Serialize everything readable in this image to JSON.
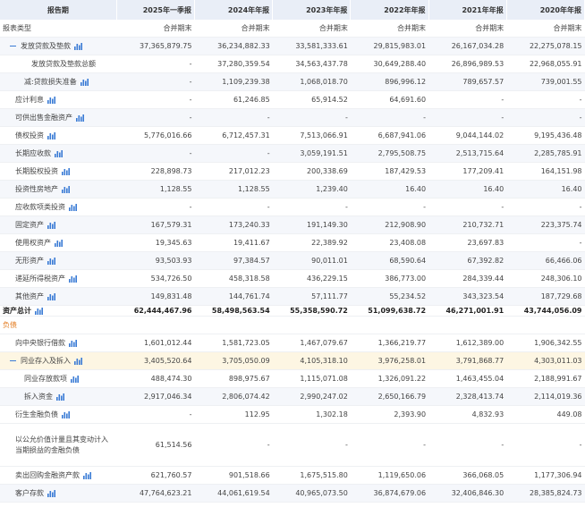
{
  "columns": [
    "报告期",
    "2025年一季报",
    "2024年年报",
    "2023年年报",
    "2022年年报",
    "2021年年报",
    "2020年年报"
  ],
  "rows": [
    {
      "label": "报表类型",
      "values": [
        "合并期末",
        "合并期末",
        "合并期末",
        "合并期末",
        "合并期末",
        "合并期末"
      ],
      "indent": 0,
      "chart": false,
      "style": "sub"
    },
    {
      "label": "发放贷款及垫款",
      "values": [
        "37,365,879.75",
        "36,234,882.33",
        "33,581,333.61",
        "29,815,983.01",
        "26,167,034.28",
        "22,275,078.15"
      ],
      "indent": 1,
      "chart": true,
      "collapse": true,
      "style": "alt"
    },
    {
      "label": "发放贷款及垫款总额",
      "values": [
        "-",
        "37,280,359.54",
        "34,563,437.78",
        "30,649,288.40",
        "26,896,989.53",
        "22,968,055.91"
      ],
      "indent": 3,
      "chart": false,
      "style": "row"
    },
    {
      "label": "减:贷款损失准备",
      "values": [
        "-",
        "1,109,239.38",
        "1,068,018.70",
        "896,996.12",
        "789,657.57",
        "739,001.55"
      ],
      "indent": 2,
      "chart": true,
      "style": "alt"
    },
    {
      "label": "应计利息",
      "values": [
        "-",
        "61,246.85",
        "65,914.52",
        "64,691.60",
        "-",
        "-"
      ],
      "indent": 1,
      "chart": true,
      "style": "row"
    },
    {
      "label": "可供出售金融资产",
      "values": [
        "-",
        "-",
        "-",
        "-",
        "-",
        "-"
      ],
      "indent": 1,
      "chart": true,
      "style": "alt"
    },
    {
      "label": "债权投资",
      "values": [
        "5,776,016.66",
        "6,712,457.31",
        "7,513,066.91",
        "6,687,941.06",
        "9,044,144.02",
        "9,195,436.48"
      ],
      "indent": 1,
      "chart": true,
      "style": "row"
    },
    {
      "label": "长期应收款",
      "values": [
        "-",
        "-",
        "3,059,191.51",
        "2,795,508.75",
        "2,513,715.64",
        "2,285,785.91"
      ],
      "indent": 1,
      "chart": true,
      "style": "alt"
    },
    {
      "label": "长期股权投资",
      "values": [
        "228,898.73",
        "217,012.23",
        "200,338.69",
        "187,429.53",
        "177,209.41",
        "164,151.98"
      ],
      "indent": 1,
      "chart": true,
      "style": "row"
    },
    {
      "label": "投资性房地产",
      "values": [
        "1,128.55",
        "1,128.55",
        "1,239.40",
        "16.40",
        "16.40",
        "16.40"
      ],
      "indent": 1,
      "chart": true,
      "style": "alt"
    },
    {
      "label": "应收款项类投资",
      "values": [
        "-",
        "-",
        "-",
        "-",
        "-",
        "-"
      ],
      "indent": 1,
      "chart": true,
      "style": "row"
    },
    {
      "label": "固定资产",
      "values": [
        "167,579.31",
        "173,240.33",
        "191,149.30",
        "212,908.90",
        "210,732.71",
        "223,375.74"
      ],
      "indent": 1,
      "chart": true,
      "style": "alt"
    },
    {
      "label": "使用权资产",
      "values": [
        "19,345.63",
        "19,411.67",
        "22,389.92",
        "23,408.08",
        "23,697.83",
        "-"
      ],
      "indent": 1,
      "chart": true,
      "style": "row"
    },
    {
      "label": "无形资产",
      "values": [
        "93,503.93",
        "97,384.57",
        "90,011.01",
        "68,590.64",
        "67,392.82",
        "66,466.06"
      ],
      "indent": 1,
      "chart": true,
      "style": "alt"
    },
    {
      "label": "递延所得税资产",
      "values": [
        "534,726.50",
        "458,318.58",
        "436,229.15",
        "386,773.00",
        "284,339.44",
        "248,306.10"
      ],
      "indent": 1,
      "chart": true,
      "style": "row"
    },
    {
      "label": "其他资产",
      "values": [
        "149,831.48",
        "144,761.74",
        "57,111.77",
        "55,234.52",
        "343,323.54",
        "187,729.68"
      ],
      "indent": 1,
      "chart": true,
      "style": "alt"
    },
    {
      "label": "资产总计",
      "values": [
        "62,444,467.96",
        "58,498,563.54",
        "55,358,590.72",
        "51,099,638.72",
        "46,271,001.91",
        "43,744,056.09"
      ],
      "indent": 0,
      "chart": true,
      "style": "total"
    },
    {
      "label": "负债",
      "values": [
        "",
        "",
        "",
        "",
        "",
        ""
      ],
      "indent": 0,
      "chart": false,
      "style": "section"
    },
    {
      "label": "向中央银行借款",
      "values": [
        "1,601,012.44",
        "1,581,723.05",
        "1,467,079.67",
        "1,366,219.77",
        "1,612,389.00",
        "1,906,342.55"
      ],
      "indent": 1,
      "chart": true,
      "style": "row"
    },
    {
      "label": "同业存入及拆入",
      "values": [
        "3,405,520.64",
        "3,705,050.09",
        "4,105,318.10",
        "3,976,258.01",
        "3,791,868.77",
        "4,303,011.03"
      ],
      "indent": 1,
      "chart": true,
      "collapse": true,
      "style": "hl"
    },
    {
      "label": "同业存放款项",
      "values": [
        "488,474.30",
        "898,975.67",
        "1,115,071.08",
        "1,326,091.22",
        "1,463,455.04",
        "2,188,991.67"
      ],
      "indent": 2,
      "chart": true,
      "style": "row"
    },
    {
      "label": "拆入资金",
      "values": [
        "2,917,046.34",
        "2,806,074.42",
        "2,990,247.02",
        "2,650,166.79",
        "2,328,413.74",
        "2,114,019.36"
      ],
      "indent": 2,
      "chart": true,
      "style": "alt"
    },
    {
      "label": "衍生金融负债",
      "values": [
        "-",
        "112.95",
        "1,302.18",
        "2,393.90",
        "4,832.93",
        "449.08"
      ],
      "indent": 1,
      "chart": true,
      "style": "row"
    },
    {
      "label": "以公允价值计量且其变动计入当期损益的金融负债",
      "values": [
        "61,514.56",
        "-",
        "-",
        "-",
        "-",
        "-"
      ],
      "indent": 1,
      "chart": false,
      "style": "multi"
    },
    {
      "label": "卖出回购金融资产款",
      "values": [
        "621,760.57",
        "901,518.66",
        "1,675,515.80",
        "1,119,650.06",
        "366,068.05",
        "1,177,306.94"
      ],
      "indent": 1,
      "chart": true,
      "style": "row"
    },
    {
      "label": "客户存款",
      "values": [
        "47,764,623.21",
        "44,061,619.54",
        "40,965,073.50",
        "36,874,679.06",
        "32,406,846.30",
        "28,385,824.73"
      ],
      "indent": 1,
      "chart": true,
      "style": "alt"
    }
  ],
  "colors": {
    "header_bg": "#e9eef7",
    "alt_bg": "#f5f7fb",
    "highlight_bg": "#fdf6e3",
    "section_text": "#e37a1c",
    "icon": "#3a7bd5"
  },
  "icons": {
    "chart": "bar-chart-icon",
    "collapse": "collapse-minus-icon"
  }
}
